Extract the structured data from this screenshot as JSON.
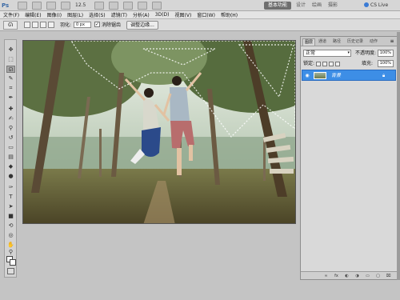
{
  "appbar": {
    "logo": "Ps",
    "zoom": "12.5",
    "workspaces": [
      "基本功能",
      "设计",
      "绘画",
      "摄影"
    ],
    "active_workspace": "基本功能",
    "cs_live": "CS Live"
  },
  "menu": [
    "文件(F)",
    "编辑(E)",
    "图像(I)",
    "图层(L)",
    "选择(S)",
    "滤镜(T)",
    "分析(A)",
    "3D(D)",
    "视图(V)",
    "窗口(W)",
    "帮助(H)"
  ],
  "options": {
    "tool_icon": "lasso-icon",
    "feather_label": "羽化:",
    "feather_value": "0 px",
    "antialias_label": "消除锯齿",
    "antialias_checked": true,
    "refine_edge_button": "调整边缘..."
  },
  "toolbox": {
    "tools": [
      "move-icon",
      "marquee-icon",
      "lasso-icon",
      "quick-select-icon",
      "crop-icon",
      "eyedropper-icon",
      "healing-icon",
      "brush-icon",
      "clone-stamp-icon",
      "history-brush-icon",
      "eraser-icon",
      "gradient-icon",
      "blur-icon",
      "dodge-icon",
      "pen-icon",
      "type-icon",
      "path-select-icon",
      "shape-icon",
      "3d-rotate-icon",
      "3d-orbit-icon",
      "hand-icon",
      "zoom-icon"
    ],
    "active_tool": "lasso-icon",
    "foreground_color": "#ffffff",
    "background_color": "#ffffff"
  },
  "panel": {
    "tabs": [
      "图层",
      "通道",
      "路径",
      "历史记录",
      "动作"
    ],
    "active_tab": "图层",
    "blend_mode": "正常",
    "opacity_label": "不透明度:",
    "opacity_value": "100%",
    "lock_label": "锁定:",
    "fill_label": "填充:",
    "fill_value": "100%",
    "layers": [
      {
        "name": "背景",
        "visible": true,
        "locked": true,
        "selected": true
      }
    ],
    "footer_icons": [
      "link-icon",
      "fx-icon",
      "mask-icon",
      "adjustment-icon",
      "group-icon",
      "new-layer-icon",
      "trash-icon"
    ]
  },
  "colors": {
    "selection": "#3d8ee6",
    "chrome": "#d9d9d9",
    "canvas_bg": "#c4c4c4"
  }
}
